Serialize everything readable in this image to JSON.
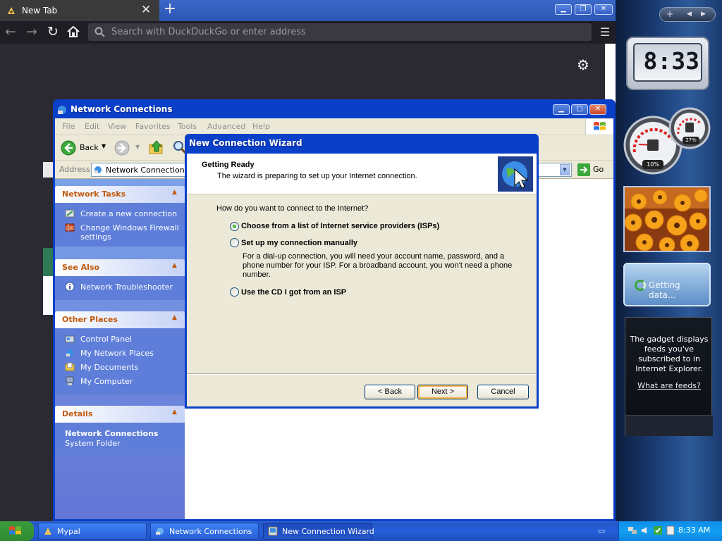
{
  "browser": {
    "tab_title": "New Tab",
    "url_placeholder": "Search with DuckDuckGo or enter address"
  },
  "network_connections": {
    "title": "Network Connections",
    "menu": [
      "File",
      "Edit",
      "View",
      "Favorites",
      "Tools",
      "Advanced",
      "Help"
    ],
    "toolbar": {
      "back_label": "Back"
    },
    "address_label": "Address",
    "address_value": "Network Connections",
    "go_label": "Go",
    "panels": {
      "network_tasks": {
        "title": "Network Tasks",
        "items": [
          "Create a new connection",
          "Change Windows Firewall settings"
        ]
      },
      "see_also": {
        "title": "See Also",
        "items": [
          "Network Troubleshooter"
        ]
      },
      "other_places": {
        "title": "Other Places",
        "items": [
          "Control Panel",
          "My Network Places",
          "My Documents",
          "My Computer"
        ]
      },
      "details": {
        "title": "Details",
        "name": "Network Connections",
        "type": "System Folder"
      }
    }
  },
  "wizard": {
    "title": "New Connection Wizard",
    "header_title": "Getting Ready",
    "header_subtitle": "The wizard is preparing to set up your Internet connection.",
    "question": "How do you want to connect to the Internet?",
    "options": [
      {
        "label": "Choose from a list of Internet service providers (ISPs)",
        "selected": true
      },
      {
        "label": "Set up my connection manually",
        "selected": false
      },
      {
        "label": "Use the CD I got from an ISP",
        "selected": false
      }
    ],
    "manual_description": "For a dial-up connection, you will need your account name, password, and a phone number for your ISP. For a broadband account, you won't need a phone number.",
    "buttons": {
      "back": "< Back",
      "next": "Next >",
      "cancel": "Cancel"
    }
  },
  "gadgets": {
    "clock_time": "8:33",
    "cpu_percent": "10%",
    "memory_percent": "27%",
    "feed_status": "Getting data...",
    "feed_info": "The gadget displays feeds you've subscribed to in Internet Explorer.",
    "feed_link": "What are feeds?"
  },
  "taskbar": {
    "items": [
      "Mypal",
      "Network Connections",
      "New Connection Wizard"
    ],
    "clock": "8:33 AM"
  },
  "colors": {
    "xp_title_blue": "#0a3fc8",
    "task_pane_orange": "#c15a0c",
    "default_button_highlight": "#f8b34a"
  }
}
